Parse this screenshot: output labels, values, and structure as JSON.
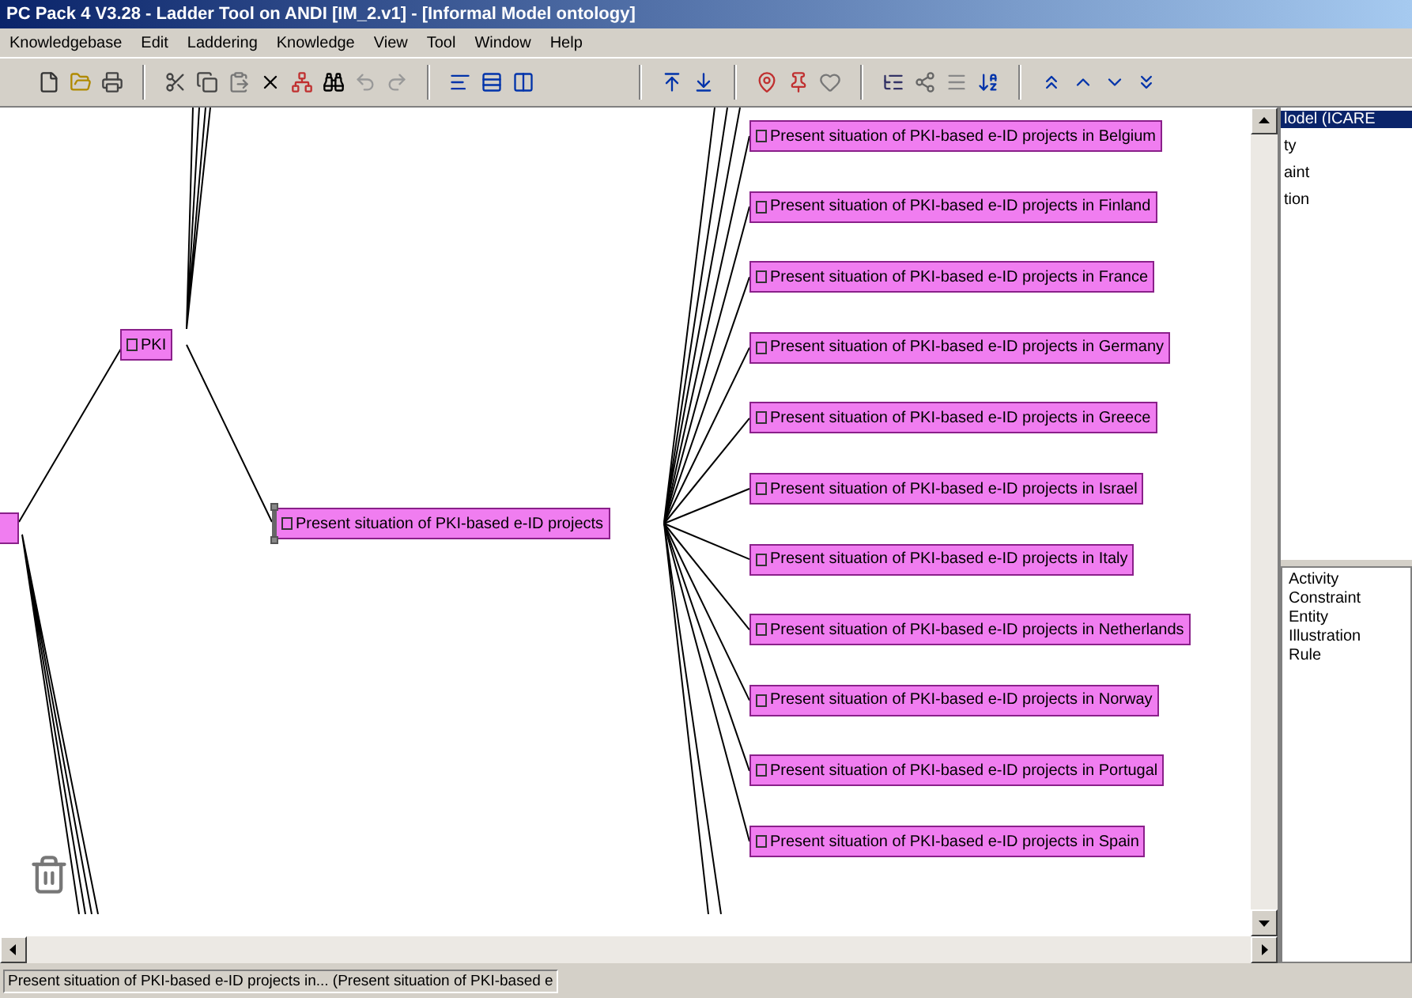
{
  "window": {
    "title": "PC Pack 4 V3.28 - Ladder Tool on ANDI [IM_2.v1] - [Informal Model ontology]"
  },
  "menu": [
    "Knowledgebase",
    "Edit",
    "Laddering",
    "Knowledge",
    "View",
    "Tool",
    "Window",
    "Help"
  ],
  "ladder": {
    "label": "PKI",
    "selected": false,
    "children": [
      {
        "label": "Present situation of PKI-based e-ID projects",
        "selected": true,
        "children": [
          {
            "label": "Present situation of PKI-based e-ID projects in Belgium",
            "selected": false
          },
          {
            "label": "Present situation of PKI-based e-ID projects in Finland",
            "selected": false
          },
          {
            "label": "Present situation of PKI-based e-ID projects in France",
            "selected": false
          },
          {
            "label": "Present situation of PKI-based e-ID projects in Germany",
            "selected": false
          },
          {
            "label": "Present situation of PKI-based e-ID projects in Greece",
            "selected": false
          },
          {
            "label": "Present situation of PKI-based e-ID projects in Israel",
            "selected": false
          },
          {
            "label": "Present situation of PKI-based e-ID projects in Italy",
            "selected": false
          },
          {
            "label": "Present situation of PKI-based e-ID projects in Netherlands",
            "selected": false
          },
          {
            "label": "Present situation of PKI-based e-ID projects in Norway",
            "selected": false
          },
          {
            "label": "Present situation of PKI-based e-ID projects in Portugal",
            "selected": false
          },
          {
            "label": "Present situation of PKI-based e-ID projects in Spain",
            "selected": false
          }
        ]
      }
    ]
  },
  "side_panel": {
    "tree_items": [
      {
        "label": "lodel (ICARE",
        "selected": true
      },
      {
        "label": "ty",
        "selected": false
      },
      {
        "label": "aint",
        "selected": false
      },
      {
        "label": "tion",
        "selected": false
      }
    ],
    "list_items": [
      "Activity",
      "Constraint",
      "Entity",
      "Illustration",
      "Rule"
    ]
  },
  "status_bar": [
    "Present situation of PKI-based e-ID projects in... (Present situation of PKI-based e"
  ]
}
